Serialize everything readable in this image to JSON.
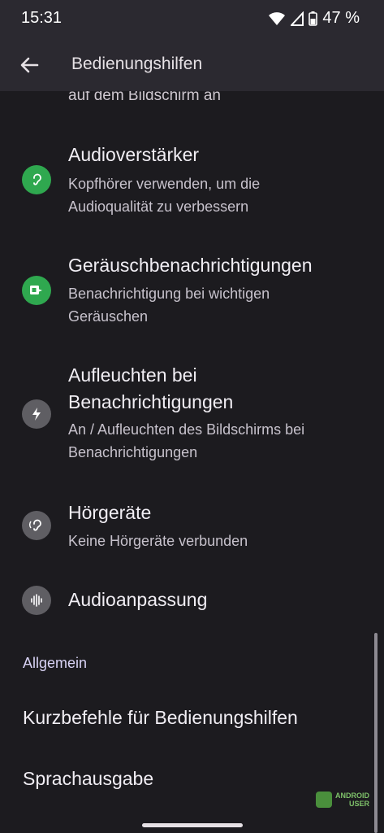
{
  "status_bar": {
    "time": "15:31",
    "battery": "47 %"
  },
  "app_bar": {
    "title": "Bedienungshilfen"
  },
  "partial_text": "auf dem Bildschirm an",
  "items": [
    {
      "title": "Audioverstärker",
      "subtitle_line1": "Kopfhörer verwenden, um die",
      "subtitle_line2": "Audioqualität zu verbessern",
      "icon": "ear-icon"
    },
    {
      "title": "Geräuschbenachrichtigungen",
      "subtitle_line1": "Benachrichtigung bei wichtigen",
      "subtitle_line2": "Geräuschen",
      "icon": "sound-notification-icon"
    },
    {
      "title_line1": "Aufleuchten bei",
      "title_line2": "Benachrichtigungen",
      "subtitle_line1": "An / Aufleuchten des Bildschirms bei",
      "subtitle_line2": "Benachrichtigungen",
      "icon": "flash-icon"
    },
    {
      "title": "Hörgeräte",
      "subtitle": "Keine Hörgeräte verbunden",
      "icon": "hearing-aid-icon"
    },
    {
      "title": "Audioanpassung",
      "icon": "audio-wave-icon"
    }
  ],
  "section_header": "Allgemein",
  "general_items": [
    {
      "title": "Kurzbefehle für Bedienungshilfen"
    },
    {
      "title": "Sprachausgabe"
    }
  ],
  "watermark": {
    "line1": "ANDROID",
    "line2": "USER"
  },
  "colors": {
    "accent_green": "#2fa84f",
    "icon_grey": "#5f5e63",
    "section_header": "#d9d3f5"
  }
}
